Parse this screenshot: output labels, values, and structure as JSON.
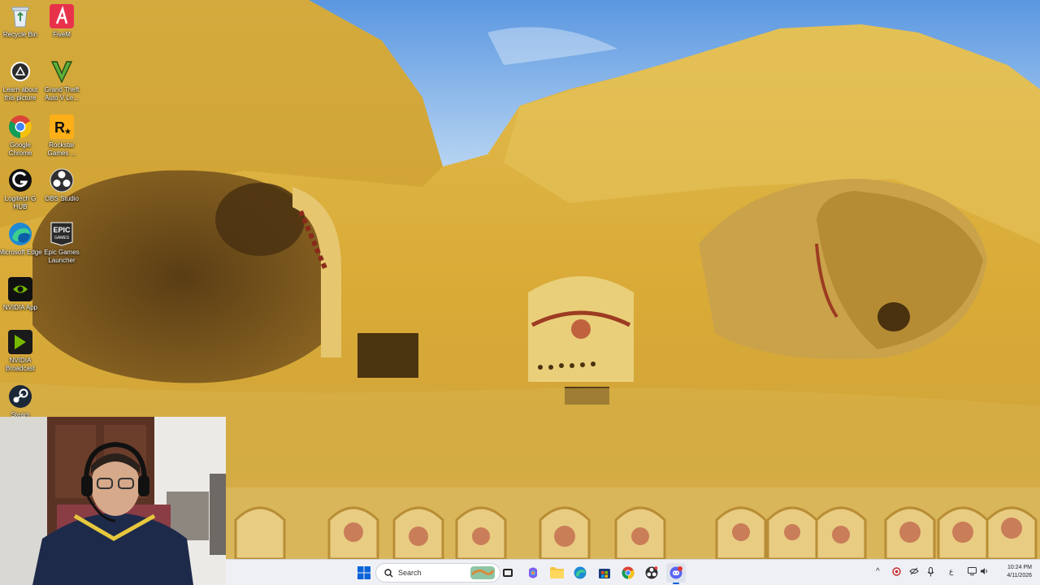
{
  "desktop_icons": [
    {
      "id": "recycle-bin",
      "label": "Recycle Bin",
      "icon": "recycle-bin-icon"
    },
    {
      "id": "fivem",
      "label": "FiveM",
      "icon": "fivem-icon"
    },
    {
      "id": "learn-about",
      "label": "Learn about this picture",
      "icon": "info-camera-icon"
    },
    {
      "id": "gta",
      "label": "Grand Theft Auto V Le...",
      "icon": "gta-v-icon"
    },
    {
      "id": "chrome",
      "label": "Google Chrome",
      "icon": "chrome-icon"
    },
    {
      "id": "rockstar",
      "label": "Rockstar Games ...",
      "icon": "rockstar-icon"
    },
    {
      "id": "logitech",
      "label": "Logitech G HUB",
      "icon": "logitech-g-icon"
    },
    {
      "id": "obs",
      "label": "OBS Studio",
      "icon": "obs-icon"
    },
    {
      "id": "edge",
      "label": "Microsoft Edge",
      "icon": "edge-icon"
    },
    {
      "id": "epic",
      "label": "Epic Games Launcher",
      "icon": "epic-games-icon"
    },
    {
      "id": "nvidia-app",
      "label": "NVIDIA App",
      "icon": "nvidia-icon"
    },
    {
      "id": "nvidia-broadcast",
      "label": "NVIDIA Broadcast",
      "icon": "nvidia-broadcast-icon"
    },
    {
      "id": "steam",
      "label": "Steam",
      "icon": "steam-icon"
    }
  ],
  "epic_icon_text": "EPIC\nGAMES",
  "taskbar": {
    "search_label": "Search",
    "clock_time": "10:24 PM",
    "clock_date": "4/11/2026"
  },
  "colors": {
    "taskbar_bg": "#eef0f5",
    "accent": "#0a64d8"
  }
}
